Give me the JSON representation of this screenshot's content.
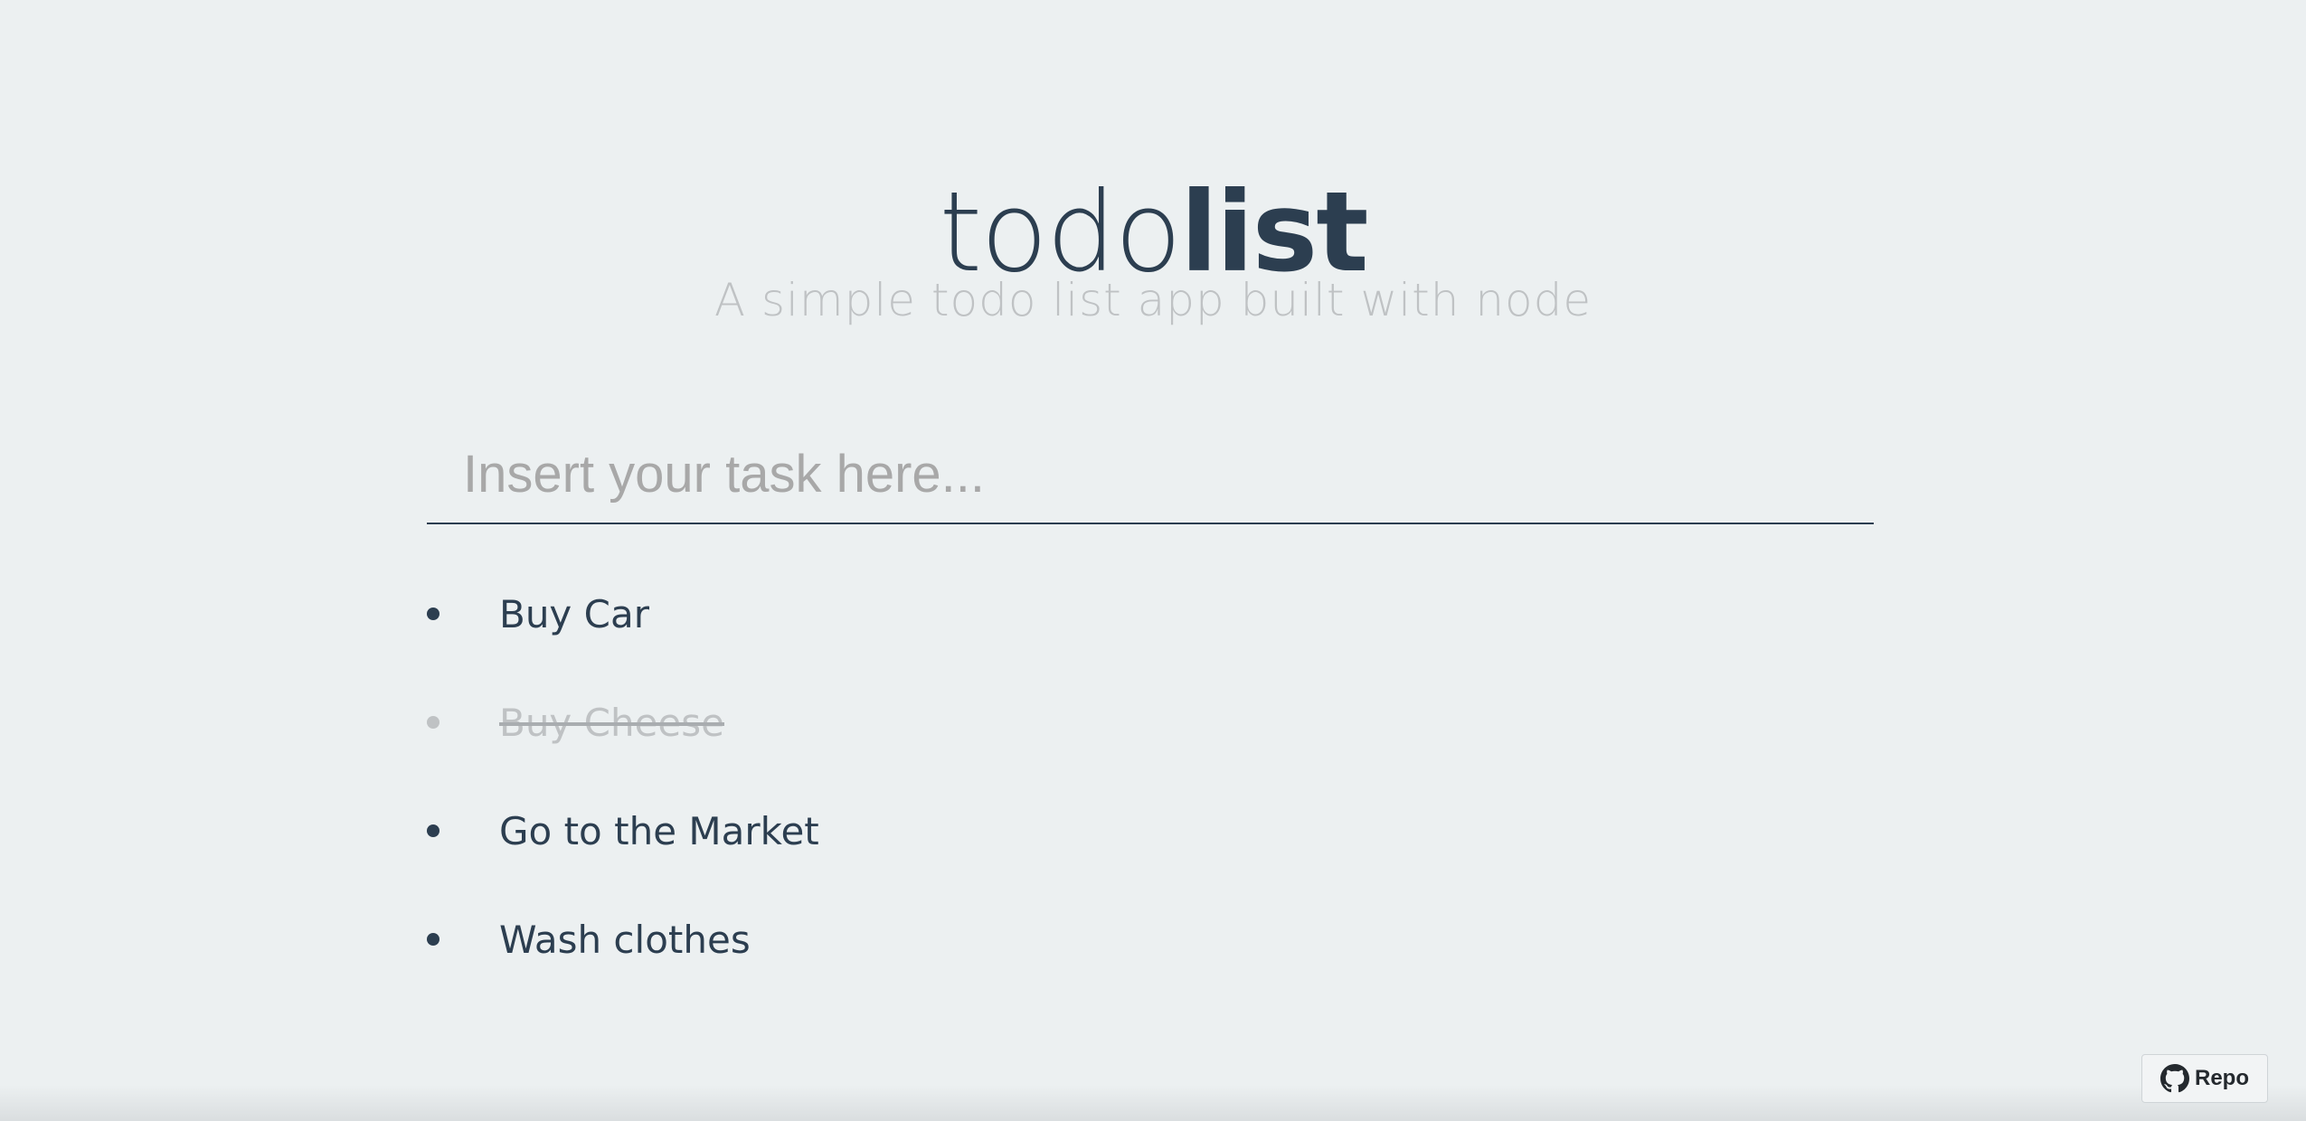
{
  "header": {
    "title_light": "todo",
    "title_bold": "list",
    "subtitle": "A simple todo list app built with node"
  },
  "input": {
    "placeholder": "Insert your task here...",
    "value": ""
  },
  "todos": [
    {
      "label": "Buy Car",
      "done": false
    },
    {
      "label": "Buy Cheese",
      "done": true
    },
    {
      "label": "Go to the Market",
      "done": false
    },
    {
      "label": "Wash clothes",
      "done": false
    }
  ],
  "repo_button": {
    "label": "Repo",
    "icon": "github-icon"
  },
  "colors": {
    "background": "#ecf0f1",
    "text": "#2c3e50",
    "muted": "#bfc2c4",
    "placeholder": "#a8a8a8"
  }
}
